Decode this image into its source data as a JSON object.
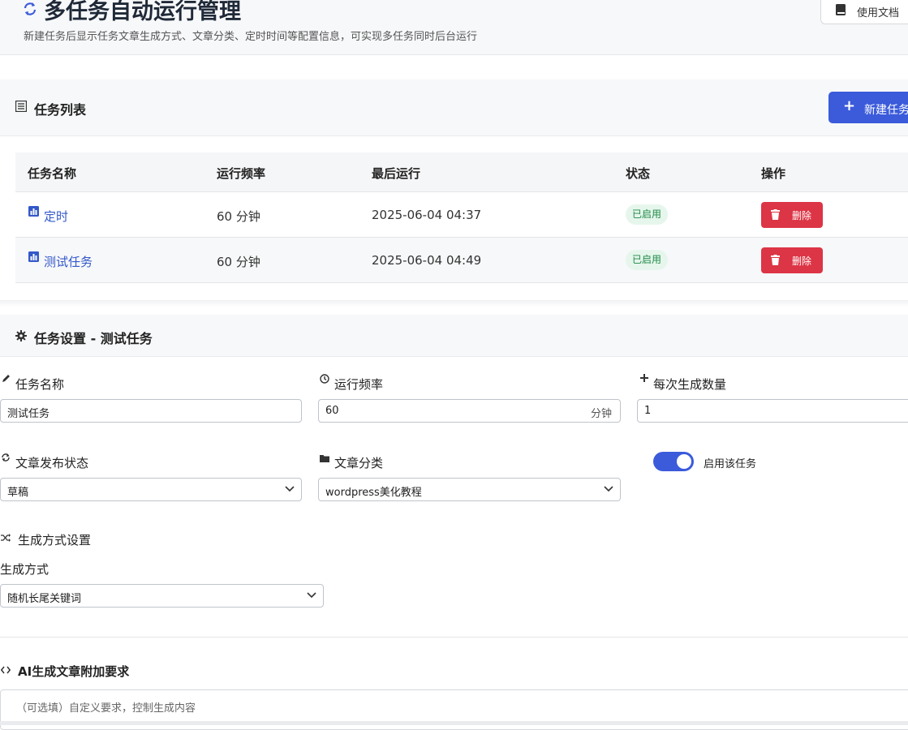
{
  "header": {
    "title": "多任务自动运行管理",
    "subtitle": "新建任务后显示任务文章生成方式、文章分类、定时时间等配置信息，可实现多任务同时后台运行",
    "docs_button": "使用文档"
  },
  "task_list": {
    "title": "任务列表",
    "new_button": "新建任务",
    "columns": [
      "任务名称",
      "运行频率",
      "最后运行",
      "状态",
      "操作"
    ],
    "rows": [
      {
        "name": "定时",
        "frequency": "60 分钟",
        "last_run": "2025-06-04 04:37",
        "status": "已启用",
        "action": "删除"
      },
      {
        "name": "测试任务",
        "frequency": "60 分钟",
        "last_run": "2025-06-04 04:49",
        "status": "已启用",
        "action": "删除"
      }
    ]
  },
  "settings": {
    "title": "任务设置 - 测试任务",
    "task_name": {
      "label": "任务名称",
      "value": "测试任务"
    },
    "frequency": {
      "label": "运行频率",
      "value": "60",
      "unit": "分钟"
    },
    "count": {
      "label": "每次生成数量",
      "value": "1"
    },
    "publish_status": {
      "label": "文章发布状态",
      "value": "草稿"
    },
    "category": {
      "label": "文章分类",
      "value": "wordpress美化教程"
    },
    "enable_toggle": {
      "label": "启用该任务",
      "on": true
    },
    "generation": {
      "section_title": "生成方式设置",
      "label": "生成方式",
      "value": "随机长尾关键词"
    },
    "ai_extra": {
      "title": "AI生成文章附加要求",
      "placeholder": "（可选填）自定义要求，控制生成内容"
    }
  },
  "colors": {
    "primary": "#3b5bdb",
    "danger": "#dc3545",
    "success_bg": "#e6f6ec",
    "success_text": "#1f8a47",
    "link": "#3358c9"
  },
  "icons": {
    "title": "sync-icon",
    "docs": "book-icon",
    "list": "list-icon",
    "new": "plus-icon",
    "row": "chart-icon",
    "delete": "trash-icon",
    "settings": "gear-icon",
    "task_name": "pencil-icon",
    "frequency": "clock-icon",
    "count": "plus-icon",
    "publish": "sync-icon",
    "category": "folder-icon",
    "generation": "shuffle-icon",
    "ai": "code-icon"
  }
}
